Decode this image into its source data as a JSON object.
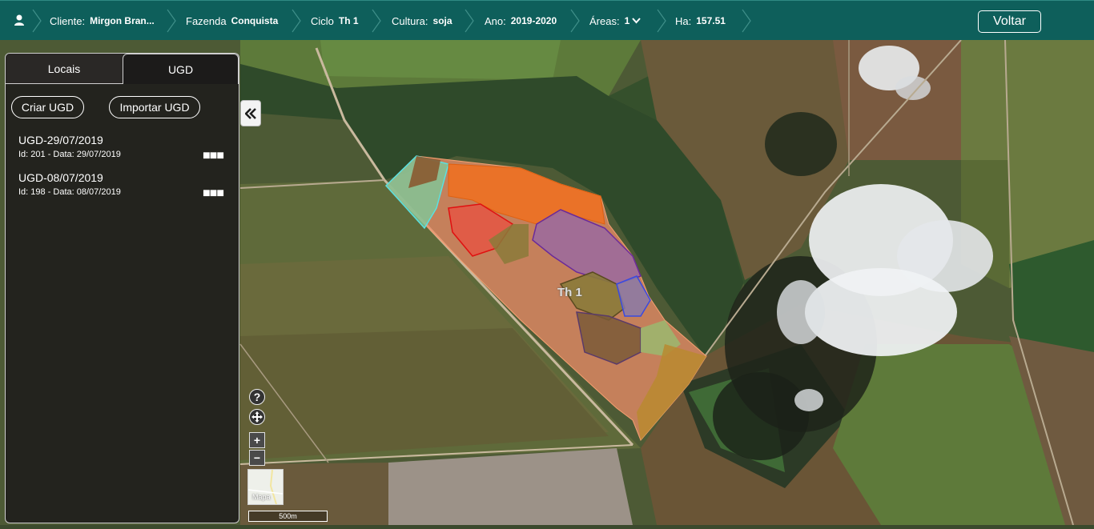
{
  "topbar": {
    "cliente_label": "Cliente:",
    "cliente_value": "Mirgon Bran...",
    "fazenda_label": "Fazenda",
    "fazenda_value": "Conquista",
    "ciclo_label": "Ciclo",
    "ciclo_value": "Th 1",
    "cultura_label": "Cultura:",
    "cultura_value": "soja",
    "ano_label": "Ano:",
    "ano_value": "2019-2020",
    "areas_label": "Áreas:",
    "areas_value": "1",
    "ha_label": "Ha:",
    "ha_value": "157.51",
    "voltar_label": "Voltar"
  },
  "panel": {
    "tabs": [
      {
        "label": "Locais",
        "active": false
      },
      {
        "label": "UGD",
        "active": true
      }
    ],
    "criar_label": "Criar UGD",
    "importar_label": "Importar UGD",
    "items": [
      {
        "title": "UGD-29/07/2019",
        "meta": "Id: 201 - Data: 29/07/2019"
      },
      {
        "title": "UGD-08/07/2019",
        "meta": "Id: 198 - Data: 08/07/2019"
      }
    ]
  },
  "map": {
    "field_label": "Th 1",
    "zoom_in": "+",
    "zoom_out": "−",
    "help": "?",
    "minimap_label": "Mapa",
    "scale_label": "500m"
  },
  "colors": {
    "topbar": "#0e5f5b",
    "zone_orange": "#f07a2a",
    "zone_salmon": "#ee8e68",
    "zone_purple": "#9a6aa0",
    "zone_olive": "#8a7a3a",
    "zone_green": "#7ec89a"
  }
}
